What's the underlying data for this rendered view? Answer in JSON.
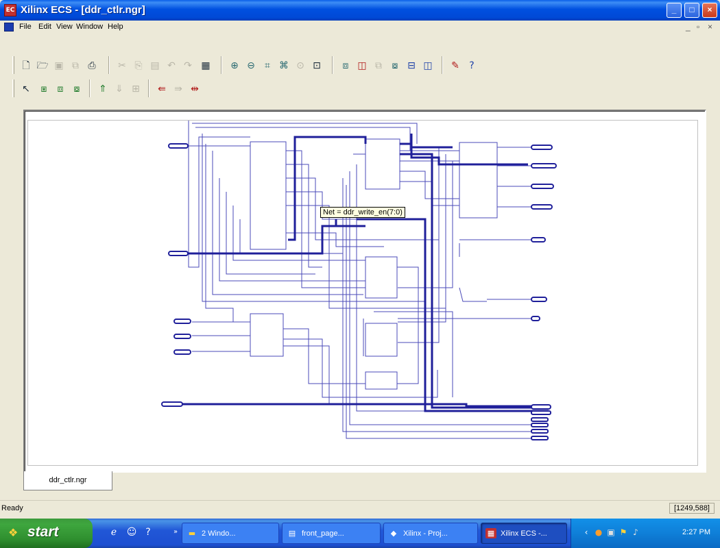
{
  "window": {
    "title": "Xilinx ECS - [ddr_ctlr.ngr]",
    "app_icon_label": "EC",
    "controls": {
      "minimize": "_",
      "maximize": "□",
      "close": "×"
    }
  },
  "menubar": {
    "items": [
      "File",
      "Edit",
      "View",
      "Window",
      "Help"
    ],
    "mdi_controls": {
      "minimize": "_",
      "restore": "▫",
      "close": "×"
    }
  },
  "toolbar1": {
    "icons": [
      "new-icon",
      "open-icon",
      "save-icon",
      "save-all-icon",
      "print-icon",
      "cut-icon",
      "copy-icon",
      "paste-icon",
      "undo-icon",
      "redo-icon",
      "find-icon",
      "zoom-in-icon",
      "zoom-out-icon",
      "zoom-full-icon",
      "zoom-box-icon",
      "zoom-selection-icon",
      "refresh-icon",
      "push-icon",
      "pop-icon",
      "top-icon",
      "tile-icon",
      "cascade-icon",
      "window-icon",
      "tool-icon",
      "help-pointer-icon"
    ]
  },
  "toolbar2": {
    "icons": [
      "select-icon",
      "schematic-1-icon",
      "schematic-2-icon",
      "schematic-3-icon",
      "push-into-icon",
      "pop-out-icon",
      "view-icon",
      "trace-back-icon",
      "trace-forward-icon",
      "trace-both-icon"
    ]
  },
  "tooltip": {
    "text": "Net = ddr_write_en(7:0)"
  },
  "tabs": [
    {
      "label": "ddr_ctlr.ngr"
    }
  ],
  "status": {
    "text": "Ready",
    "coords": "[1249,588]"
  },
  "taskbar": {
    "start_label": "start",
    "tasks": [
      {
        "label": "2 Windo...",
        "icon": "folder-icon"
      },
      {
        "label": "front_page...",
        "icon": "document-icon"
      },
      {
        "label": "Xilinx - Proj...",
        "icon": "xilinx-project-icon"
      },
      {
        "label": "Xilinx ECS -...",
        "icon": "xilinx-ecs-icon"
      }
    ],
    "clock": "2:27 PM"
  },
  "colors": {
    "wire": "#1f1f9a",
    "wire_thin": "#4a4ab8",
    "titlebar": "#0050e0"
  }
}
